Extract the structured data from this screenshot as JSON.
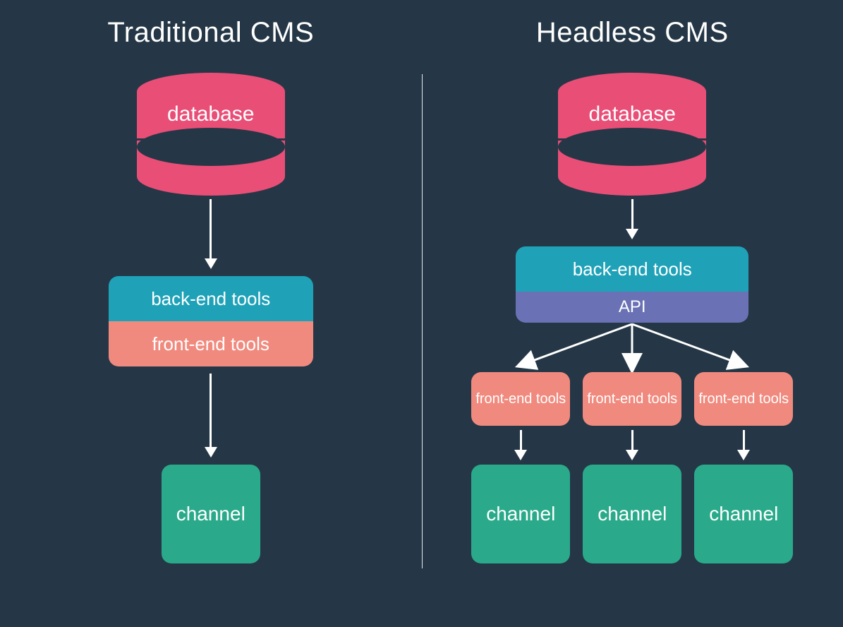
{
  "left": {
    "title": "Traditional CMS",
    "database": "database",
    "backend": "back-end tools",
    "frontend": "front-end tools",
    "channel": "channel"
  },
  "right": {
    "title": "Headless CMS",
    "database": "database",
    "backend": "back-end tools",
    "api": "API",
    "frontends": [
      "front-end tools",
      "front-end tools",
      "front-end tools"
    ],
    "channels": [
      "channel",
      "channel",
      "channel"
    ]
  },
  "colors": {
    "background": "#253746",
    "pink": "#e94e77",
    "teal": "#1fa2b8",
    "salmon": "#f18a7e",
    "purple": "#6a72b5",
    "green": "#2aaa8a",
    "white": "#ffffff"
  }
}
